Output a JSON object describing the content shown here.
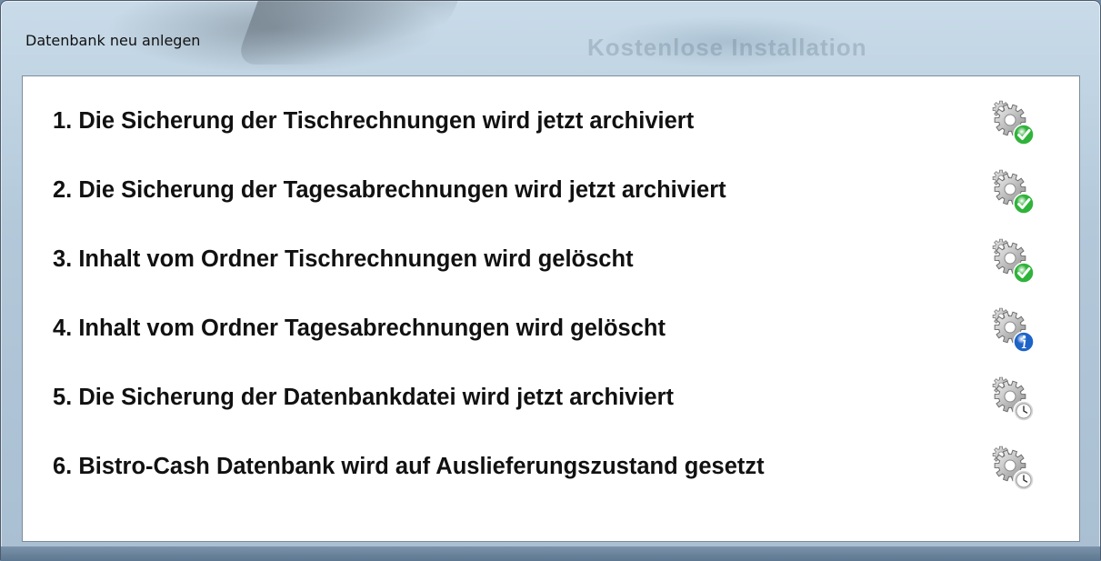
{
  "window": {
    "title": "Datenbank neu anlegen",
    "background_text": "Kostenlose Installation"
  },
  "steps": [
    {
      "label": "1. Die Sicherung der Tischrechnungen wird jetzt archiviert",
      "status": "done",
      "icon": "gear-check-icon",
      "badge_color": "#2fb33a"
    },
    {
      "label": "2. Die Sicherung der Tagesabrechnungen wird jetzt archiviert",
      "status": "done",
      "icon": "gear-check-icon",
      "badge_color": "#2fb33a"
    },
    {
      "label": "3. Inhalt vom Ordner Tischrechnungen wird gelöscht",
      "status": "done",
      "icon": "gear-check-icon",
      "badge_color": "#2fb33a"
    },
    {
      "label": "4. Inhalt vom Ordner Tagesabrechnungen wird gelöscht",
      "status": "in-progress",
      "icon": "gear-info-icon",
      "badge_color": "#1e63c8"
    },
    {
      "label": "5. Die Sicherung der Datenbankdatei wird jetzt archiviert",
      "status": "pending",
      "icon": "gear-clock-icon",
      "badge_color": "#d8d8d8"
    },
    {
      "label": "6. Bistro-Cash Datenbank wird auf Auslieferungszustand gesetzt",
      "status": "pending",
      "icon": "gear-clock-icon",
      "badge_color": "#d8d8d8"
    }
  ]
}
